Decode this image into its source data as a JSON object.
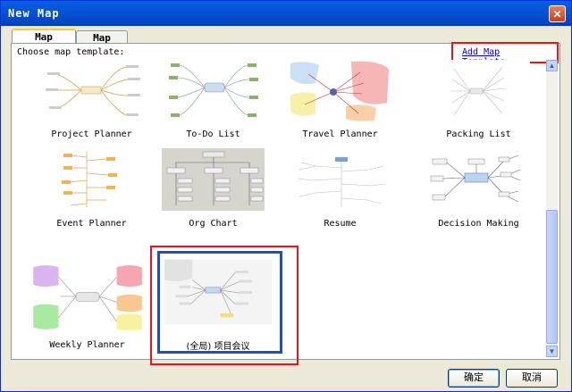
{
  "window": {
    "title": "New Map"
  },
  "tabs": [
    {
      "label": "Map Templates",
      "active": true
    },
    {
      "label": "Map Styles",
      "active": false
    }
  ],
  "panel": {
    "choose_label": "Choose map template:",
    "add_link": "Add Map Template..."
  },
  "templates": [
    {
      "label": "Project Planner"
    },
    {
      "label": "To-Do List"
    },
    {
      "label": "Travel Planner"
    },
    {
      "label": "Packing List"
    },
    {
      "label": "Event Planner"
    },
    {
      "label": "Org Chart"
    },
    {
      "label": "Resume"
    },
    {
      "label": "Decision Making"
    },
    {
      "label": "Weekly Planner"
    },
    {
      "label": "(全局) 项目会议",
      "selected": true
    }
  ],
  "buttons": {
    "ok": "确定",
    "cancel": "取消"
  },
  "colors": {
    "title_bar": "#0653d8",
    "highlight_red": "#e8141c",
    "selection_blue": "#1f4fbf"
  }
}
